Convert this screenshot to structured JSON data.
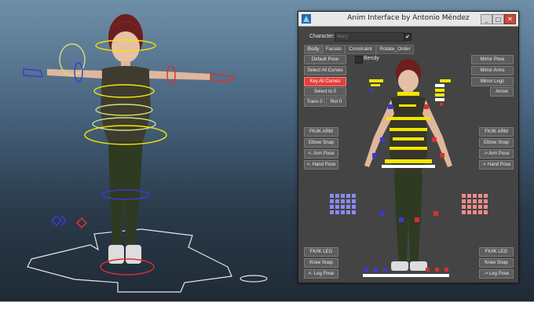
{
  "window": {
    "title": "Anim Interface by Antonio Méndez",
    "min": "_",
    "max": "□",
    "close": "✕"
  },
  "character": {
    "label": "Character:",
    "value": "Mary",
    "checked": "✔"
  },
  "tabs": [
    "Body",
    "Facials",
    "Constraint",
    "Rotate_Order"
  ],
  "left_buttons_top": [
    "Default Pose",
    "Select All Curves",
    "Key All Curves",
    "Select to 0"
  ],
  "trans_button": "Trans 0",
  "rot_button": "Rot 0",
  "bendy_label": "Bendy",
  "right_buttons_top": [
    "Mirror Pose",
    "Mirror Arms",
    "Mirror Legs",
    "Arrow"
  ],
  "arm_left": [
    "FK/IK ARM",
    "Elbow Snap",
    "<- Arm Pose",
    "<- Hand Pose"
  ],
  "arm_right": [
    "FK/IK ARM",
    "Elbow Snap",
    "-> Arm Pose",
    "-> Hand Pose"
  ],
  "leg_left": [
    "FK/IK LEG",
    "Knee Snap",
    "<- Leg Pose"
  ],
  "leg_right": [
    "FK/IK LEG",
    "Knee Snap",
    "-> Leg Pose"
  ],
  "colors": {
    "ctrl_yellow": "#f2e600",
    "ctrl_blue": "#3a3ad0",
    "ctrl_red": "#d83030",
    "finger_blue": "#8a8af0",
    "finger_red": "#f08a8a",
    "key_red": "#e5403b"
  },
  "icons": [
    "app-icon",
    "minimize-icon",
    "maximize-icon",
    "close-icon",
    "checkmark-icon"
  ]
}
